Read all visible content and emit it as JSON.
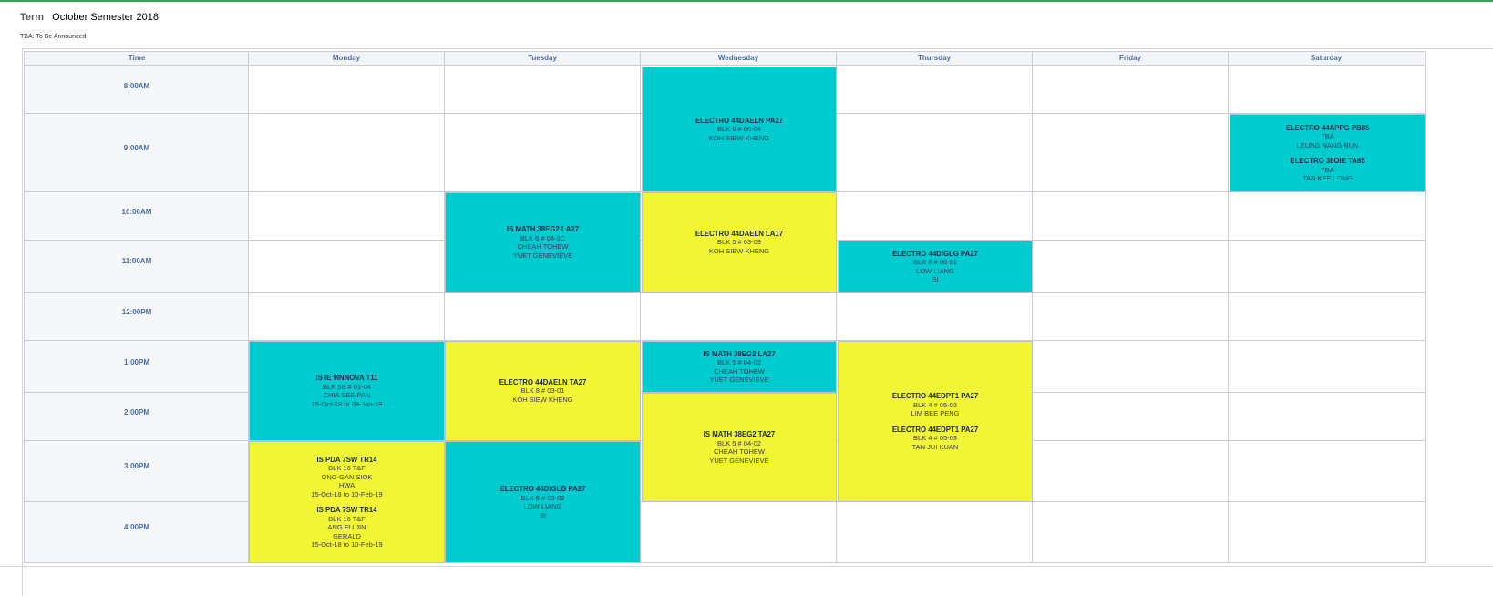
{
  "term": {
    "label": "Term",
    "value": "October Semester 2018"
  },
  "note": "TBA: To Be Announced",
  "headers": [
    "Time",
    "Monday",
    "Tuesday",
    "Wednesday",
    "Thursday",
    "Friday",
    "Saturday"
  ],
  "times": [
    "8:00AM",
    "9:00AM",
    "10:00AM",
    "11:00AM",
    "12:00PM",
    "1:00PM",
    "2:00PM",
    "3:00PM",
    "4:00PM"
  ],
  "events": [
    {
      "id": "wed-electro-44daeln-pa27",
      "color": "teal",
      "groups": [
        {
          "code": "ELECTRO 44DAELN PA27",
          "lines": [
            "BLK 6 # 06-04",
            "KOH SIEW KHENG"
          ]
        }
      ]
    },
    {
      "id": "sat-electro-44appg-38oie",
      "color": "teal",
      "groups": [
        {
          "code": "ELECTRO 44APPG PB85",
          "lines": [
            "TBA",
            "LEUNG NANG-BUN"
          ]
        },
        {
          "code": "ELECTRO 38OIE TA85",
          "lines": [
            "TBA",
            "TAN KEE LONG"
          ]
        }
      ]
    },
    {
      "id": "tue-is-math-38eg2-la27",
      "color": "teal",
      "groups": [
        {
          "code": "IS MATH 38EG2 LA27",
          "lines": [
            "BLK 6 # 04-3C",
            "CHEAH TOHEW",
            "YUET GENEVIEVE"
          ]
        }
      ]
    },
    {
      "id": "wed-electro-44daeln-la17",
      "color": "yellow",
      "groups": [
        {
          "code": "ELECTRO 44DAELN LA17",
          "lines": [
            "BLK 5 # 03-09",
            "KOH SIEW KHENG"
          ]
        }
      ]
    },
    {
      "id": "thu-electro-44diglg-pa27",
      "color": "teal",
      "groups": [
        {
          "code": "ELECTRO 44DIGLG PA27",
          "lines": [
            "BLK 6 # 06-01",
            "LOW LIANG",
            "SI"
          ]
        }
      ]
    },
    {
      "id": "mon-is-ie-9innova-t11",
      "color": "teal",
      "groups": [
        {
          "code": "IS IE 9INNOVA T11",
          "lines": [
            "BLK 5B # 01-04",
            "CHIA SEE PAN",
            "15-Oct-18 to 28-Jan-19"
          ]
        }
      ]
    },
    {
      "id": "tue-electro-44daeln-ta27",
      "color": "yellow",
      "groups": [
        {
          "code": "ELECTRO 44DAELN TA27",
          "lines": [
            "BLK 8 # 03-01",
            "KOH SIEW KHENG"
          ]
        }
      ]
    },
    {
      "id": "wed-is-math-38eg2-la27",
      "color": "teal",
      "groups": [
        {
          "code": "IS MATH 38EG2 LA27",
          "lines": [
            "BLK 5 # 04-02",
            "CHEAH TOHEW",
            "YUET GENEVIEVE"
          ]
        }
      ]
    },
    {
      "id": "wed-is-math-38eg2-ta27",
      "color": "yellow",
      "groups": [
        {
          "code": "IS MATH 38EG2 TA27",
          "lines": [
            "BLK 5 # 04-02",
            "CHEAH TOHEW",
            "YUET GENEVIEVE"
          ]
        }
      ]
    },
    {
      "id": "thu-electro-44edpt1-pa27",
      "color": "yellow",
      "groups": [
        {
          "code": "ELECTRO 44EDPT1 PA27",
          "lines": [
            "BLK 4 # 05-03",
            "LIM BEE PENG"
          ]
        },
        {
          "code": "ELECTRO 44EDPT1 PA27",
          "lines": [
            "BLK 4 # 05-03",
            "TAN JUI KUAN"
          ]
        }
      ]
    },
    {
      "id": "mon-is-pda-7sw-tr14",
      "color": "yellow",
      "groups": [
        {
          "code": "IS PDA 7SW TR14",
          "lines": [
            "BLK 16 T&F",
            "ONG-GAN SIOK",
            "HWA",
            "15-Oct-18 to 10-Feb-19"
          ]
        },
        {
          "code": "IS PDA 7SW TR14",
          "lines": [
            "BLK 16 T&F",
            "ANG EU JIN",
            "GERALD",
            "15-Oct-18 to 10-Feb-19"
          ]
        }
      ]
    },
    {
      "id": "tue-electro-44diglg-pa27",
      "color": "teal",
      "groups": [
        {
          "code": "ELECTRO 44DIGLG PA27",
          "lines": [
            "BLK 8 # 03-02",
            "LOW LIANG",
            "SI"
          ]
        }
      ]
    }
  ]
}
